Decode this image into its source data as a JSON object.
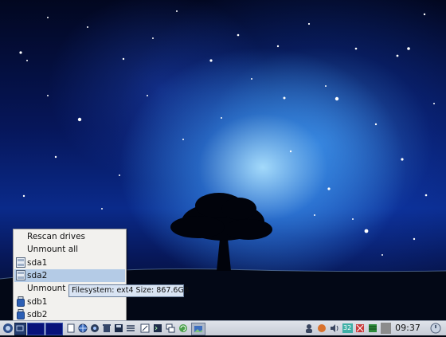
{
  "drive_menu": {
    "items": [
      {
        "label": "Rescan drives",
        "icon": "none"
      },
      {
        "label": "Unmount all",
        "icon": "none"
      },
      {
        "label": "sda1",
        "icon": "hard-drive-icon"
      },
      {
        "label": "sda2",
        "icon": "hard-drive-icon",
        "selected": true
      },
      {
        "label": "Unmount",
        "icon": "none"
      },
      {
        "label": "sdb1",
        "icon": "usb-drive-icon"
      },
      {
        "label": "sdb2",
        "icon": "usb-drive-icon"
      }
    ]
  },
  "tooltip": {
    "text": "Filesystem: ext4 Size: 867.6GB"
  },
  "taskbar": {
    "clock": "09:37",
    "tray_number": "32",
    "launchers": [
      "menu-icon",
      "desktop-1",
      "desktop-2",
      "desktop-3",
      "file-icon",
      "globe-icon",
      "network-icon",
      "trash-icon",
      "disk-icon",
      "settings-icon",
      "edit-icon",
      "terminal-icon",
      "windows-icon",
      "refresh-icon",
      "image-icon"
    ]
  },
  "colors": {
    "menu_selected": "#b4cbe6",
    "taskbar": "#d3d8e0",
    "tooltip": "#d9e4f3"
  }
}
